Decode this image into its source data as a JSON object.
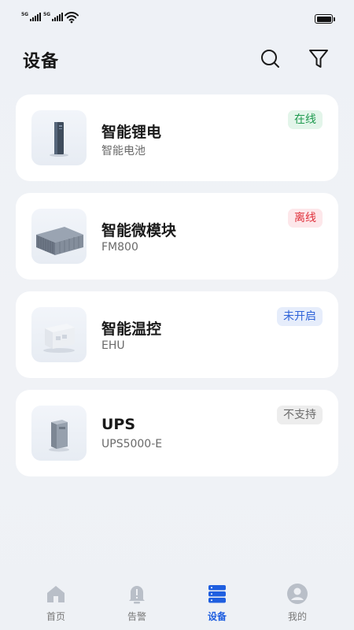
{
  "status_bar": {
    "sim1_tag": "5G",
    "sim2_tag": "5G",
    "battery_level": 1.0
  },
  "header": {
    "title": "设备",
    "icons": [
      "search-icon",
      "filter-icon"
    ]
  },
  "devices": [
    {
      "name": "智能锂电",
      "subtitle": "智能电池",
      "status": "在线",
      "status_color": "#1f9a4f",
      "image": "battery-cabinet"
    },
    {
      "name": "智能微模块",
      "subtitle": "FM800",
      "status": "离线",
      "status_color": "#e0323c",
      "image": "micro-module"
    },
    {
      "name": "智能温控",
      "subtitle": "EHU",
      "status": "未开启",
      "status_color": "#2f63d8",
      "image": "thermal-unit"
    },
    {
      "name": "UPS",
      "subtitle": "UPS5000-E",
      "status": "不支持",
      "status_color": "#6b6b6b",
      "image": "ups-cabinet"
    }
  ],
  "tabbar": {
    "active": "设备",
    "accent": "#1f5fe0",
    "tabs": [
      {
        "label": "首页",
        "icon": "home-icon"
      },
      {
        "label": "告警",
        "icon": "bell-icon"
      },
      {
        "label": "设备",
        "icon": "devices-icon"
      },
      {
        "label": "我的",
        "icon": "profile-icon"
      }
    ]
  }
}
